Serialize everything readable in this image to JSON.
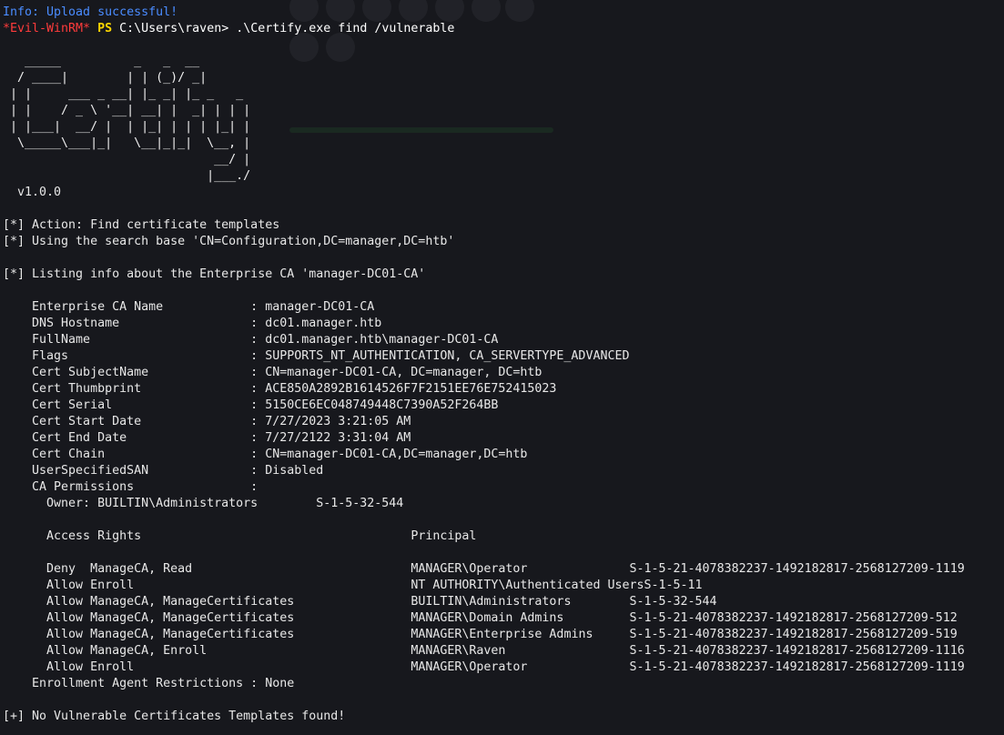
{
  "window": {
    "info_line": "Info: Upload successful!"
  },
  "prompt": {
    "shell_tag": "*Evil-WinRM*",
    "ps_label": "PS",
    "path": "C:\\Users\\raven>",
    "command": ".\\Certify.exe find /vulnerable"
  },
  "banner": {
    "ascii": [
      "   _____          _   _  __",
      "  / ____|        | | (_)/ _|",
      " | |     ___ _ __| |_ _| |_ _   _",
      " | |    / _ \\ '__| __| |  _| | | |",
      " | |___|  __/ |  | |_| | | | |_| |",
      "  \\_____\\___|_|   \\__|_|_|  \\__, |",
      "                             __/ |",
      "                            |___./"
    ],
    "version": "  v1.0.0"
  },
  "messages": {
    "action": "[*] Action: Find certificate templates",
    "search_base": "[*] Using the search base 'CN=Configuration,DC=manager,DC=htb'",
    "listing": "[*] Listing info about the Enterprise CA 'manager-DC01-CA'",
    "result": "[+] No Vulnerable Certificates Templates found!"
  },
  "ca_info": [
    {
      "key": "Enterprise CA Name",
      "value": "manager-DC01-CA"
    },
    {
      "key": "DNS Hostname",
      "value": "dc01.manager.htb"
    },
    {
      "key": "FullName",
      "value": "dc01.manager.htb\\manager-DC01-CA"
    },
    {
      "key": "Flags",
      "value": "SUPPORTS_NT_AUTHENTICATION, CA_SERVERTYPE_ADVANCED"
    },
    {
      "key": "Cert SubjectName",
      "value": "CN=manager-DC01-CA, DC=manager, DC=htb"
    },
    {
      "key": "Cert Thumbprint",
      "value": "ACE850A2892B1614526F7F2151EE76E752415023"
    },
    {
      "key": "Cert Serial",
      "value": "5150CE6EC048749448C7390A52F264BB"
    },
    {
      "key": "Cert Start Date",
      "value": "7/27/2023 3:21:05 AM"
    },
    {
      "key": "Cert End Date",
      "value": "7/27/2122 3:31:04 AM"
    },
    {
      "key": "Cert Chain",
      "value": "CN=manager-DC01-CA,DC=manager,DC=htb"
    },
    {
      "key": "UserSpecifiedSAN",
      "value": "Disabled"
    },
    {
      "key": "CA Permissions",
      "value": ""
    }
  ],
  "owner": {
    "label": "Owner: BUILTIN\\Administrators",
    "sid": "S-1-5-32-544"
  },
  "permissions_header": {
    "rights": "Access Rights",
    "principal": "Principal"
  },
  "permissions": [
    {
      "type": "Deny",
      "rights": "ManageCA, Read",
      "principal": "MANAGER\\Operator",
      "sid": "S-1-5-21-4078382237-1492182817-2568127209-1119"
    },
    {
      "type": "Allow",
      "rights": "Enroll",
      "principal": "NT AUTHORITY\\Authenticated Users",
      "sid": "S-1-5-11"
    },
    {
      "type": "Allow",
      "rights": "ManageCA, ManageCertificates",
      "principal": "BUILTIN\\Administrators",
      "sid": "S-1-5-32-544"
    },
    {
      "type": "Allow",
      "rights": "ManageCA, ManageCertificates",
      "principal": "MANAGER\\Domain Admins",
      "sid": "S-1-5-21-4078382237-1492182817-2568127209-512"
    },
    {
      "type": "Allow",
      "rights": "ManageCA, ManageCertificates",
      "principal": "MANAGER\\Enterprise Admins",
      "sid": "S-1-5-21-4078382237-1492182817-2568127209-519"
    },
    {
      "type": "Allow",
      "rights": "ManageCA, Enroll",
      "principal": "MANAGER\\Raven",
      "sid": "S-1-5-21-4078382237-1492182817-2568127209-1116"
    },
    {
      "type": "Allow",
      "rights": "Enroll",
      "principal": "MANAGER\\Operator",
      "sid": "S-1-5-21-4078382237-1492182817-2568127209-1119"
    }
  ],
  "enrollment_agent": "    Enrollment Agent Restrictions : None",
  "colors": {
    "background": "#17181d",
    "info": "#4a8cff",
    "evil_tag": "#ff3b3b",
    "ps": "#ffd600",
    "text": "#e8e8e8"
  }
}
